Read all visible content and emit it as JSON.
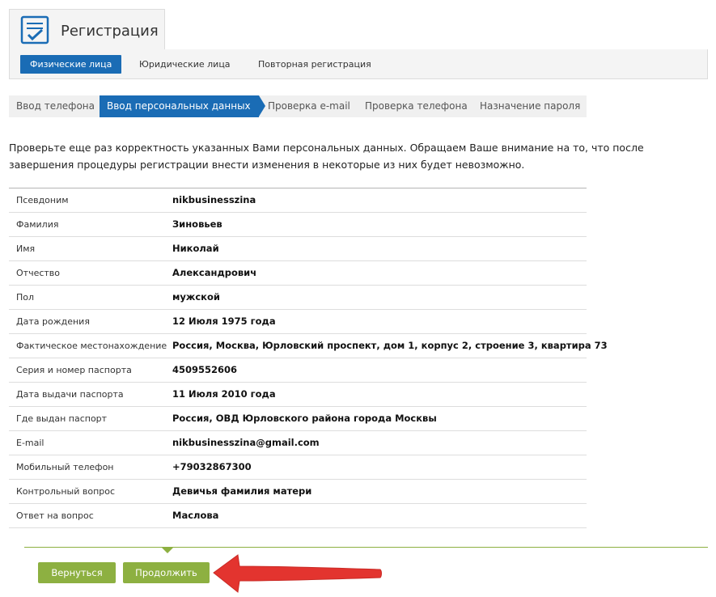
{
  "header": {
    "title": "Регистрация",
    "tabs": [
      {
        "label": "Физические лица",
        "active": true
      },
      {
        "label": "Юридические лица",
        "active": false
      },
      {
        "label": "Повторная регистрация",
        "active": false
      }
    ]
  },
  "steps": [
    {
      "label": "Ввод телефона",
      "active": false
    },
    {
      "label": "Ввод персональных данных",
      "active": true
    },
    {
      "label": "Проверка e-mail",
      "active": false
    },
    {
      "label": "Проверка телефона",
      "active": false
    },
    {
      "label": "Назначение пароля",
      "active": false
    }
  ],
  "intro": "Проверьте еще раз корректность указанных Вами персональных данных. Обращаем Ваше внимание на то, что после завершения процедуры регистрации внести изменения в некоторые из них будет невозможно.",
  "fields": [
    {
      "label": "Псевдоним",
      "value": "nikbusinesszina"
    },
    {
      "label": "Фамилия",
      "value": "Зиновьев"
    },
    {
      "label": "Имя",
      "value": "Николай"
    },
    {
      "label": "Отчество",
      "value": "Александрович"
    },
    {
      "label": "Пол",
      "value": "мужской"
    },
    {
      "label": "Дата рождения",
      "value": "12 Июля 1975 года"
    },
    {
      "label": "Фактическое местонахождение",
      "value": "Россия, Москва, Юрловский проспект, дом 1, корпус 2, строение 3, квартира 73"
    },
    {
      "label": "Серия и номер паспорта",
      "value": "4509552606"
    },
    {
      "label": "Дата выдачи паспорта",
      "value": "11 Июля 2010 года"
    },
    {
      "label": "Где выдан паспорт",
      "value": "Россия, ОВД Юрловского района города Москвы"
    },
    {
      "label": "E-mail",
      "value": "nikbusinesszina@gmail.com"
    },
    {
      "label": "Мобильный телефон",
      "value": "+79032867300"
    },
    {
      "label": "Контрольный вопрос",
      "value": "Девичья фамилия матери"
    },
    {
      "label": "Ответ на вопрос",
      "value": "Маслова"
    }
  ],
  "buttons": {
    "back": "Вернуться",
    "continue": "Продолжить"
  },
  "colors": {
    "primary": "#1a6cb5",
    "button_green": "#8db041",
    "annotation_arrow": "#e3342f"
  },
  "icons": {
    "logo": "checkbox-form-icon",
    "annotation": "red-arrow-annotation"
  }
}
